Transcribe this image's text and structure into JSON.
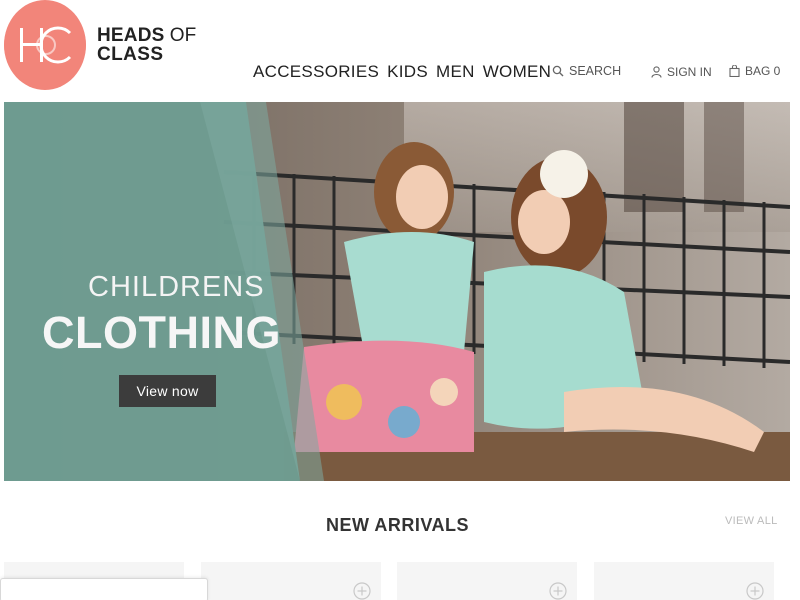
{
  "brand": {
    "logo_text": "HC",
    "name_line1_bold": "HEADS",
    "name_line1_light": "OF",
    "name_line2": "CLASS",
    "logo_color": "#f2857a"
  },
  "nav": {
    "items": [
      {
        "label": "ACCESSORIES"
      },
      {
        "label": "KIDS"
      },
      {
        "label": "MEN"
      },
      {
        "label": "WOMEN"
      }
    ]
  },
  "utility": {
    "search_label": "SEARCH",
    "signin_label": "SIGN IN",
    "bag_label": "BAG 0",
    "search_icon": "search-icon",
    "user_icon": "user-icon",
    "bag_icon": "bag-icon"
  },
  "hero": {
    "title_line1": "CHILDRENS",
    "title_line2": "CLOTHING",
    "button_label": "View now",
    "panel_color": "#6e9d92",
    "button_color": "#3c3c3c"
  },
  "arrivals": {
    "title": "NEW ARRIVALS",
    "view_all": "VIEW ALL",
    "cards": [
      {
        "id": "product-card-1",
        "has_plus": false
      },
      {
        "id": "product-card-2",
        "has_plus": true
      },
      {
        "id": "product-card-3",
        "has_plus": true
      },
      {
        "id": "product-card-4",
        "has_plus": true
      }
    ]
  }
}
